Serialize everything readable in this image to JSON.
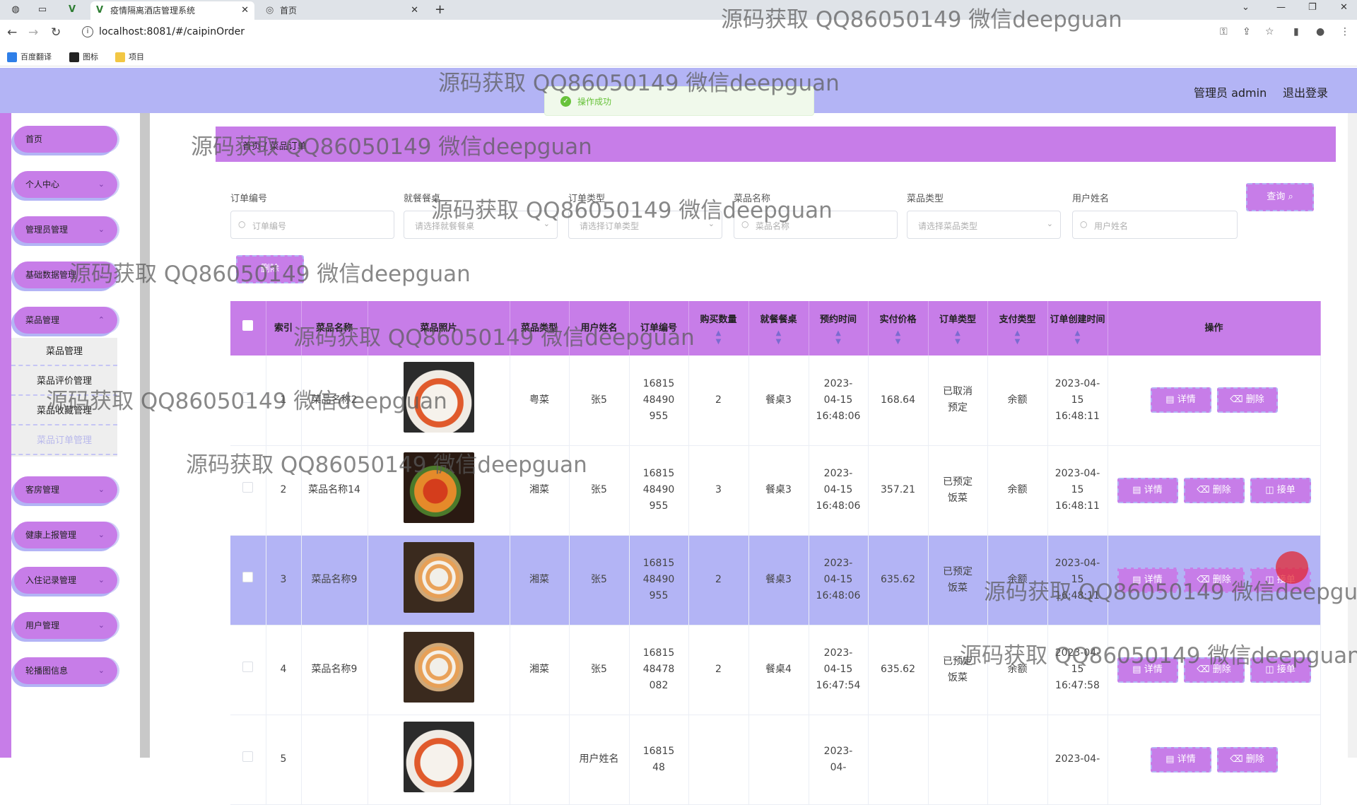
{
  "browser": {
    "tabs": [
      {
        "title": "疫情隔离酒店管理系统",
        "active": true
      },
      {
        "title": "首页",
        "active": false
      }
    ],
    "url": "localhost:8081/#/caipinOrder",
    "bookmarks": [
      "百度翻译",
      "图标",
      "项目"
    ]
  },
  "header": {
    "user": "管理员 admin",
    "logout": "退出登录"
  },
  "toast": "操作成功",
  "sidebar": {
    "items": [
      {
        "label": "首页",
        "expandable": false
      },
      {
        "label": "个人中心",
        "expandable": true
      },
      {
        "label": "管理员管理",
        "expandable": true
      },
      {
        "label": "基础数据管理",
        "expandable": true
      },
      {
        "label": "菜品管理",
        "expandable": true
      },
      {
        "label": "客房管理",
        "expandable": true
      },
      {
        "label": "健康上报管理",
        "expandable": true
      },
      {
        "label": "入住记录管理",
        "expandable": true
      },
      {
        "label": "用户管理",
        "expandable": true
      },
      {
        "label": "轮播图信息",
        "expandable": true
      }
    ],
    "submenu": [
      "菜品管理",
      "菜品评价管理",
      "菜品收藏管理",
      "菜品订单管理"
    ]
  },
  "breadcrumb": "首页 / 菜品订单",
  "filters": [
    {
      "label": "订单编号",
      "placeholder": "订单编号",
      "kind": "input"
    },
    {
      "label": "就餐餐桌",
      "placeholder": "请选择就餐餐桌",
      "kind": "select"
    },
    {
      "label": "订单类型",
      "placeholder": "请选择订单类型",
      "kind": "select"
    },
    {
      "label": "菜品名称",
      "placeholder": "菜品名称",
      "kind": "input"
    },
    {
      "label": "菜品类型",
      "placeholder": "请选择菜品类型",
      "kind": "select"
    },
    {
      "label": "用户姓名",
      "placeholder": "用户姓名",
      "kind": "input"
    }
  ],
  "query_label": "查询",
  "delete_label": "删除",
  "table": {
    "columns": [
      "索引",
      "菜品名称",
      "菜品照片",
      "菜品类型",
      "用户姓名",
      "订单编号",
      "购买数量",
      "就餐餐桌",
      "预约时间",
      "实付价格",
      "订单类型",
      "支付类型",
      "订单创建时间",
      "操作"
    ],
    "rows": [
      {
        "index": "1",
        "name": "菜品名称2",
        "photo": "a",
        "type": "粤菜",
        "user": "张5",
        "order_no": "1681548490955",
        "qty": "2",
        "table": "餐桌3",
        "reserve": "2023-04-15 16:48:06",
        "price": "168.64",
        "order_type": "已取消预定",
        "pay": "余额",
        "created": "2023-04-15 16:48:11",
        "highlight": false,
        "actions": [
          "详情",
          "删除"
        ]
      },
      {
        "index": "2",
        "name": "菜品名称14",
        "photo": "b",
        "type": "湘菜",
        "user": "张5",
        "order_no": "1681548490955",
        "qty": "3",
        "table": "餐桌3",
        "reserve": "2023-04-15 16:48:06",
        "price": "357.21",
        "order_type": "已预定饭菜",
        "pay": "余额",
        "created": "2023-04-15 16:48:11",
        "highlight": false,
        "actions": [
          "详情",
          "删除",
          "接单"
        ]
      },
      {
        "index": "3",
        "name": "菜品名称9",
        "photo": "c",
        "type": "湘菜",
        "user": "张5",
        "order_no": "1681548490955",
        "qty": "2",
        "table": "餐桌3",
        "reserve": "2023-04-15 16:48:06",
        "price": "635.62",
        "order_type": "已预定饭菜",
        "pay": "余额",
        "created": "2023-04-15 16:48:11",
        "highlight": true,
        "actions": [
          "详情",
          "删除",
          "接单"
        ]
      },
      {
        "index": "4",
        "name": "菜品名称9",
        "photo": "c",
        "type": "湘菜",
        "user": "张5",
        "order_no": "1681548478082",
        "qty": "2",
        "table": "餐桌4",
        "reserve": "2023-04-15 16:47:54",
        "price": "635.62",
        "order_type": "已预定饭菜",
        "pay": "余额",
        "created": "2023-04-15 16:47:58",
        "highlight": false,
        "actions": [
          "详情",
          "删除",
          "接单"
        ]
      },
      {
        "index": "5",
        "name": "",
        "photo": "a",
        "type": "",
        "user": "用户姓名",
        "order_no": "1681548",
        "qty": "",
        "table": "",
        "reserve": "2023-04-",
        "price": "",
        "order_type": "",
        "pay": "",
        "created": "2023-04-",
        "highlight": false,
        "actions": [
          "详情",
          "删除"
        ]
      }
    ]
  },
  "watermark": "源码获取 QQ86050149 微信deepguan"
}
